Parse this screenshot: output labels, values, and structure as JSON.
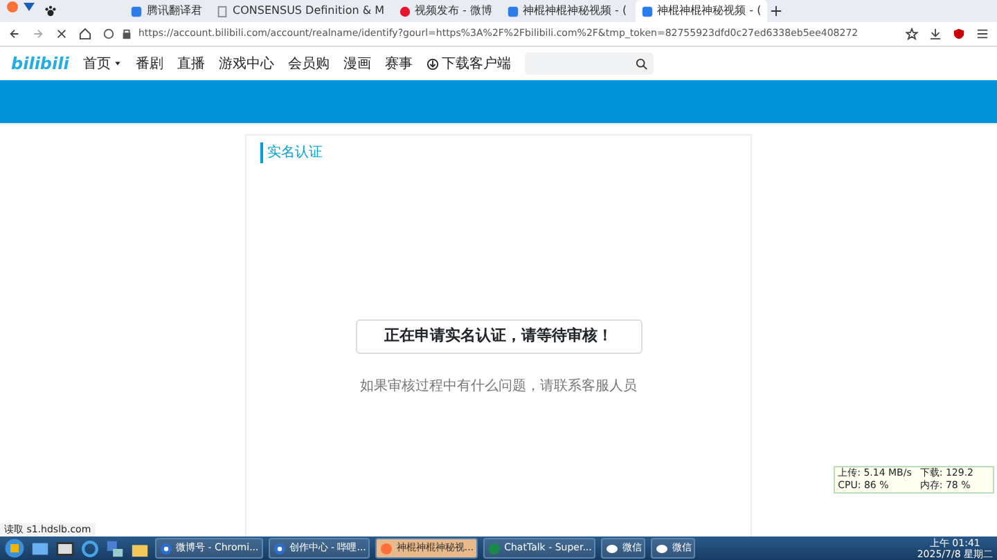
{
  "browser": {
    "tabs": [
      {
        "selected": false
      },
      {
        "title": "腾讯翻译君",
        "selected": false
      },
      {
        "title": "CONSENSUS Definition & M",
        "selected": false
      },
      {
        "title": "视频发布 - 微博",
        "selected": false
      },
      {
        "title": "神棍神棍神秘视频 - (",
        "selected": false
      },
      {
        "title": "神棍神棍神秘视频 - (",
        "selected": true
      }
    ],
    "url": "https://account.bilibili.com/account/realname/identify?gourl=https%3A%2F%2Fbilibili.com%2F&tmp_token=82755923dfd0c27ed6338eb5ee408272"
  },
  "site": {
    "logo": "bilibili",
    "nav": [
      {
        "label": "首页",
        "kind": "dropdown"
      },
      {
        "label": "番剧",
        "kind": "link"
      },
      {
        "label": "直播",
        "kind": "link"
      },
      {
        "label": "游戏中心",
        "kind": "link"
      },
      {
        "label": "会员购",
        "kind": "link"
      },
      {
        "label": "漫画",
        "kind": "link"
      },
      {
        "label": "赛事",
        "kind": "link"
      },
      {
        "label": "下载客户端",
        "kind": "download"
      }
    ]
  },
  "page": {
    "section_title": "实名认证",
    "message": "正在申请实名认证，请等待审核！",
    "note": "如果审核过程中有什么问题，请联系客服人员"
  },
  "status_text": "读取 s1.hdslb.com",
  "net_monitor": {
    "upload": "上传: 5.14 MB/s",
    "download": "下载: 129.2",
    "cpu": "CPU: 86 %",
    "memory": "内存: 78 %"
  },
  "taskbar": {
    "windows": [
      {
        "label": "微博号 - Chromi...",
        "active": false
      },
      {
        "label": "创作中心 - 哔哩...",
        "active": false
      },
      {
        "label": "神棍神棍神秘视...",
        "active": true
      },
      {
        "label": "ChatTalk - Super...",
        "active": false
      },
      {
        "label": "微信",
        "active": false
      },
      {
        "label": "微信",
        "active": false
      }
    ],
    "time": "上午 01:41",
    "date": "2025/7/8 星期二"
  }
}
